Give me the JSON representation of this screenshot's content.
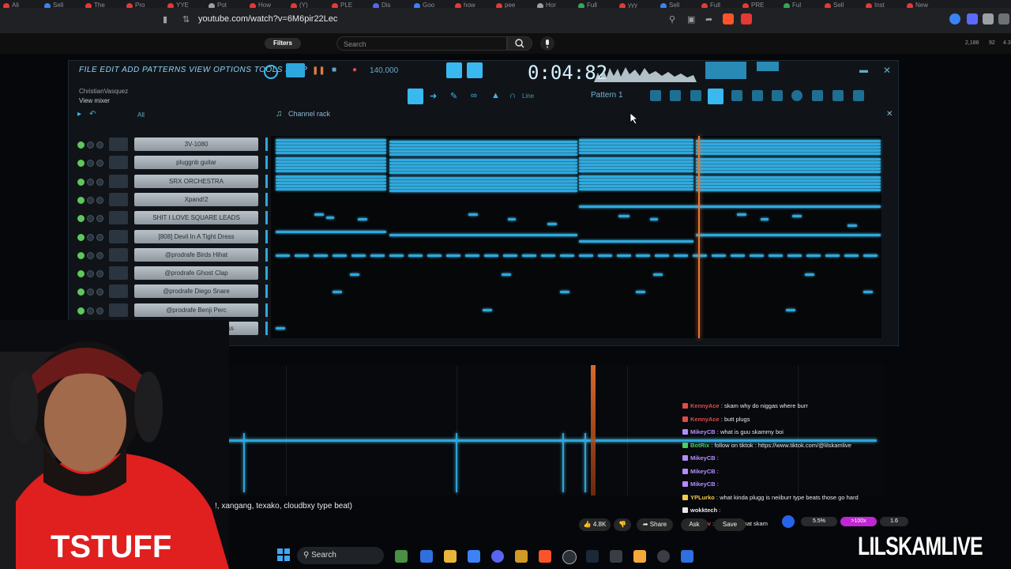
{
  "browser": {
    "url": "youtube.com/watch?v=6M6pir22Lec",
    "tabs": [
      {
        "label": "Ali",
        "color": "#e53935"
      },
      {
        "label": "Sell",
        "color": "#3b82f6"
      },
      {
        "label": "The",
        "color": "#e53935"
      },
      {
        "label": "Pro",
        "color": "#e53935"
      },
      {
        "label": "YYE",
        "color": "#e53935"
      },
      {
        "label": "Pot",
        "color": "#9aa0a6"
      },
      {
        "label": "How",
        "color": "#e53935"
      },
      {
        "label": "(Y)",
        "color": "#e53935"
      },
      {
        "label": "PLE",
        "color": "#e53935"
      },
      {
        "label": "Dis",
        "color": "#5865f2"
      },
      {
        "label": "Goo",
        "color": "#3b82f6"
      },
      {
        "label": "how",
        "color": "#e53935"
      },
      {
        "label": "pee",
        "color": "#e53935"
      },
      {
        "label": "Hor",
        "color": "#9aa0a6"
      },
      {
        "label": "Full",
        "color": "#34a853"
      },
      {
        "label": "yyy",
        "color": "#e53935"
      },
      {
        "label": "Sell",
        "color": "#3b82f6"
      },
      {
        "label": "Full",
        "color": "#e53935"
      },
      {
        "label": "PRE",
        "color": "#e53935"
      },
      {
        "label": "Ful",
        "color": "#34a853"
      },
      {
        "label": "Sell",
        "color": "#e53935"
      },
      {
        "label": "Inst",
        "color": "#e53935"
      },
      {
        "label": "New",
        "color": "#e53935"
      }
    ],
    "extensions_colors": [
      "#fb542b",
      "#e53935",
      "#3b82f6",
      "#5b6bff",
      "#9aa0a6"
    ]
  },
  "youtube": {
    "filters_label": "Filters",
    "search_placeholder": "Search",
    "likes": "4.8K",
    "share_label": "Share",
    "ask_label": "Ask",
    "save_label": "Save",
    "caption": "!, xangang, texako, cloudbxy type beat)",
    "topright_stats": [
      "2,186",
      "92",
      "4.3"
    ]
  },
  "fl": {
    "menu": "FILE EDIT ADD PATTERNS VIEW OPTIONS TOOLS HELP",
    "tempo": "140.000",
    "time": "0:04:82",
    "project_user": "ChristianVasquez",
    "project_view": "View mixer",
    "pattern_label": "Pattern 1",
    "line_label": "Line",
    "rack_title": "Channel rack",
    "filter_all": "All",
    "channels": [
      "3V-1080",
      "pluggnb guitar",
      "SRX ORCHESTRA",
      "Xpand!2",
      "SHIT I LOVE SQUARE LEADS",
      "[808] Devil In A Tight Dress",
      "@prodrafe Birds Hihat",
      "@prodrafe Ghost Clap",
      "@prodrafe Diego Snare",
      "@prodrafe Benji Perc",
      "[OH] Devil In A Tight Dress"
    ]
  },
  "chat": {
    "messages": [
      {
        "user": "KennyAce",
        "text": "skam why do niggas where burr",
        "color": "#e04b4b"
      },
      {
        "user": "KennyAce",
        "text": "butt plugs",
        "color": "#e04b4b"
      },
      {
        "user": "MikeyCB",
        "text": "what is guu skammy boi",
        "color": "#b58cff"
      },
      {
        "user": "BotRix",
        "text": "follow on tiktok : https://www.tiktok.com/@lilskamlive",
        "color": "#46d160"
      },
      {
        "user": "MikeyCB",
        "text": "",
        "color": "#b58cff"
      },
      {
        "user": "MikeyCB",
        "text": "",
        "color": "#b58cff"
      },
      {
        "user": "MikeyCB",
        "text": "",
        "color": "#b58cff"
      },
      {
        "user": "YPLurko",
        "text": "what kinda plugg is neiiburr type beats those go hard",
        "color": "#f2c94c"
      },
      {
        "user": "wokktech",
        "text": "",
        "color": "#e8e8e8"
      },
      {
        "user": "skamtv",
        "text": "you said what skam",
        "color": "#e04b4b"
      }
    ]
  },
  "overlay": {
    "stat1": "5.5%",
    "stat2": ">100x",
    "stat3": "1.6",
    "brand": "LILSKAMLIVE"
  },
  "taskbar": {
    "search_label": "Search"
  }
}
